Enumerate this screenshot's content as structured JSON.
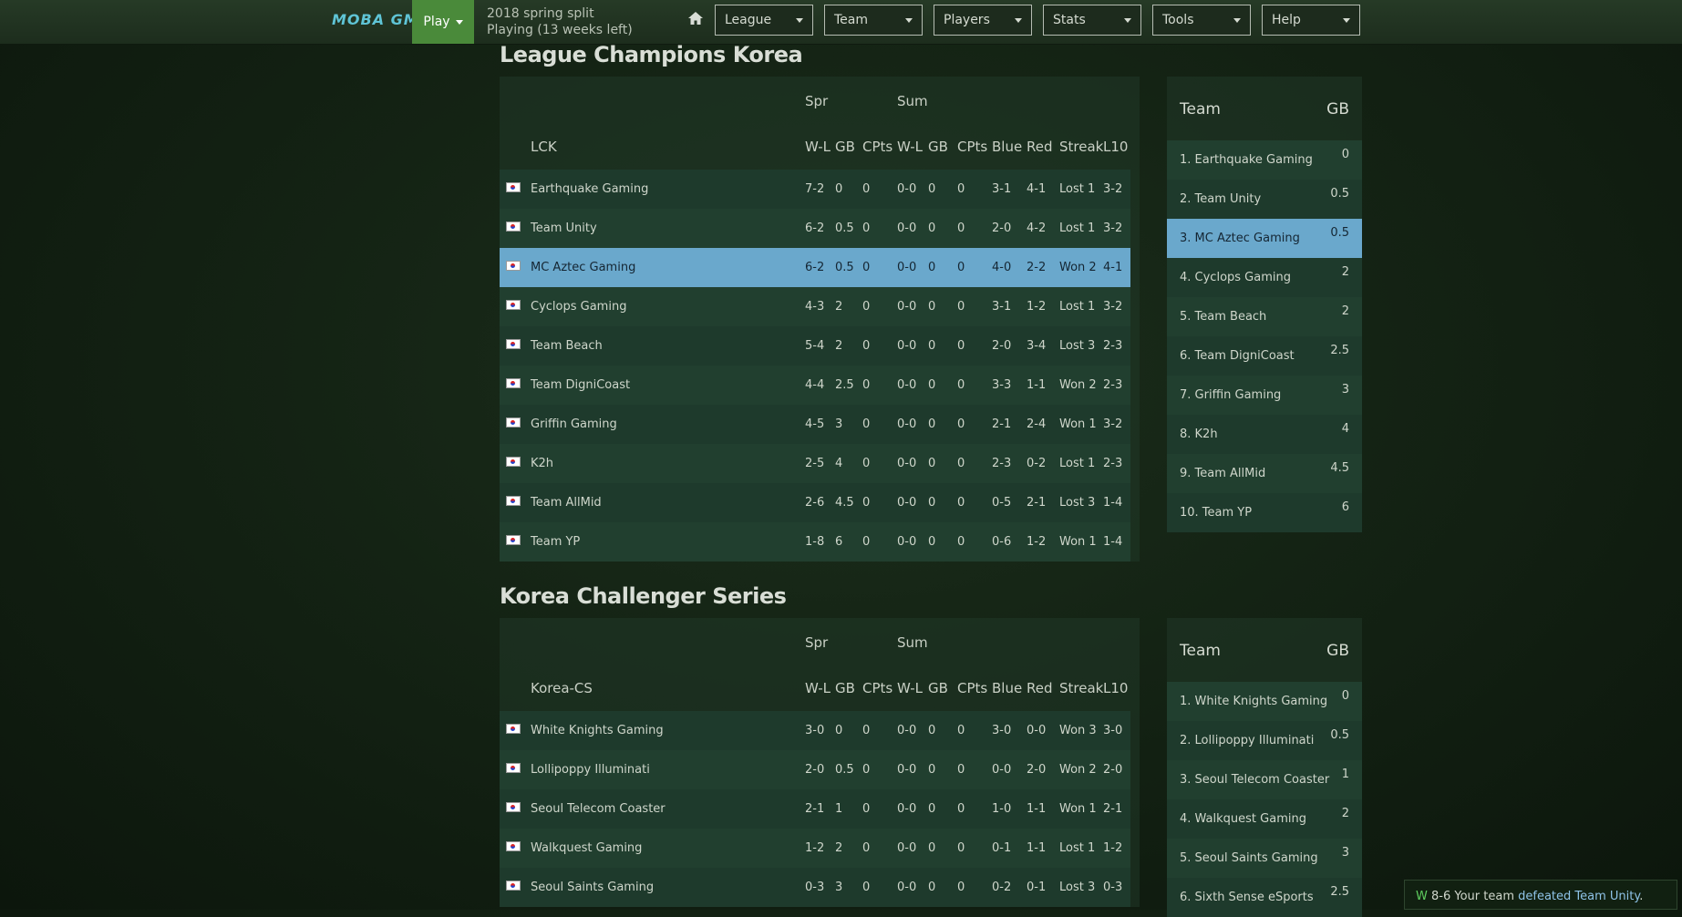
{
  "nav": {
    "logo": "MOBA GM",
    "play_label": "Play",
    "season_line1": "2018 spring split",
    "season_line2": "Playing (13 weeks left)",
    "menus": [
      "League",
      "Team",
      "Players",
      "Stats",
      "Tools",
      "Help"
    ]
  },
  "columns": {
    "spr": "Spr",
    "sum": "Sum",
    "wl": "W-L",
    "gb": "GB",
    "cpts": "CPts",
    "wl2": "W-L",
    "gb2": "GB",
    "cpts2": "CPts",
    "blue": "Blue",
    "red": "Red",
    "streak": "Streak",
    "l10": "L10"
  },
  "leagues": [
    {
      "title": "League Champions Korea",
      "code": "LCK",
      "rows": [
        [
          "Earthquake Gaming",
          "7-2",
          "0",
          "0",
          "0-0",
          "0",
          "0",
          "3-1",
          "4-1",
          "Lost 1",
          "3-2"
        ],
        [
          "Team Unity",
          "6-2",
          "0.5",
          "0",
          "0-0",
          "0",
          "0",
          "2-0",
          "4-2",
          "Lost 1",
          "3-2"
        ],
        [
          "MC Aztec Gaming",
          "6-2",
          "0.5",
          "0",
          "0-0",
          "0",
          "0",
          "4-0",
          "2-2",
          "Won 2",
          "4-1"
        ],
        [
          "Cyclops Gaming",
          "4-3",
          "2",
          "0",
          "0-0",
          "0",
          "0",
          "3-1",
          "1-2",
          "Lost 1",
          "3-2"
        ],
        [
          "Team Beach",
          "5-4",
          "2",
          "0",
          "0-0",
          "0",
          "0",
          "2-0",
          "3-4",
          "Lost 3",
          "2-3"
        ],
        [
          "Team DigniCoast",
          "4-4",
          "2.5",
          "0",
          "0-0",
          "0",
          "0",
          "3-3",
          "1-1",
          "Won 2",
          "2-3"
        ],
        [
          "Griffin Gaming",
          "4-5",
          "3",
          "0",
          "0-0",
          "0",
          "0",
          "2-1",
          "2-4",
          "Won 1",
          "3-2"
        ],
        [
          "K2h",
          "2-5",
          "4",
          "0",
          "0-0",
          "0",
          "0",
          "2-3",
          "0-2",
          "Lost 1",
          "2-3"
        ],
        [
          "Team AllMid",
          "2-6",
          "4.5",
          "0",
          "0-0",
          "0",
          "0",
          "0-5",
          "2-1",
          "Lost 3",
          "1-4"
        ],
        [
          "Team YP",
          "1-8",
          "6",
          "0",
          "0-0",
          "0",
          "0",
          "0-6",
          "1-2",
          "Won 1",
          "1-4"
        ]
      ],
      "sidebar_header": {
        "team": "Team",
        "gb": "GB"
      },
      "sidebar": [
        [
          "1. Earthquake Gaming",
          "0"
        ],
        [
          "2. Team Unity",
          "0.5"
        ],
        [
          "3. MC Aztec Gaming",
          "0.5"
        ],
        [
          "4. Cyclops Gaming",
          "2"
        ],
        [
          "5. Team Beach",
          "2"
        ],
        [
          "6. Team DigniCoast",
          "2.5"
        ],
        [
          "7. Griffin Gaming",
          "3"
        ],
        [
          "8. K2h",
          "4"
        ],
        [
          "9. Team AllMid",
          "4.5"
        ],
        [
          "10. Team YP",
          "6"
        ]
      ]
    },
    {
      "title": "Korea Challenger Series",
      "code": "Korea-CS",
      "rows": [
        [
          "White Knights Gaming",
          "3-0",
          "0",
          "0",
          "0-0",
          "0",
          "0",
          "3-0",
          "0-0",
          "Won 3",
          "3-0"
        ],
        [
          "Lollipoppy Illuminati",
          "2-0",
          "0.5",
          "0",
          "0-0",
          "0",
          "0",
          "0-0",
          "2-0",
          "Won 2",
          "2-0"
        ],
        [
          "Seoul Telecom Coaster",
          "2-1",
          "1",
          "0",
          "0-0",
          "0",
          "0",
          "1-0",
          "1-1",
          "Won 1",
          "2-1"
        ],
        [
          "Walkquest Gaming",
          "1-2",
          "2",
          "0",
          "0-0",
          "0",
          "0",
          "0-1",
          "1-1",
          "Lost 1",
          "1-2"
        ],
        [
          "Seoul Saints Gaming",
          "0-3",
          "3",
          "0",
          "0-0",
          "0",
          "0",
          "0-2",
          "0-1",
          "Lost 3",
          "0-3"
        ]
      ],
      "sidebar_header": {
        "team": "Team",
        "gb": "GB"
      },
      "sidebar": [
        [
          "1. White Knights Gaming",
          "0"
        ],
        [
          "2. Lollipoppy Illuminati",
          "0.5"
        ],
        [
          "3. Seoul Telecom Coaster",
          "1"
        ],
        [
          "4. Walkquest Gaming",
          "2"
        ],
        [
          "5. Seoul Saints Gaming",
          "3"
        ],
        [
          "6. Sixth Sense eSports",
          "2.5"
        ]
      ]
    }
  ],
  "user_team": "MC Aztec Gaming",
  "toast": {
    "result": "W",
    "score": "8-6",
    "text": "Your team",
    "link": "defeated Team Unity",
    "end": "."
  },
  "colors": {
    "highlight": "#6aa8cc",
    "play_button": "#4a8a3a",
    "win": "#5fcf5f"
  }
}
